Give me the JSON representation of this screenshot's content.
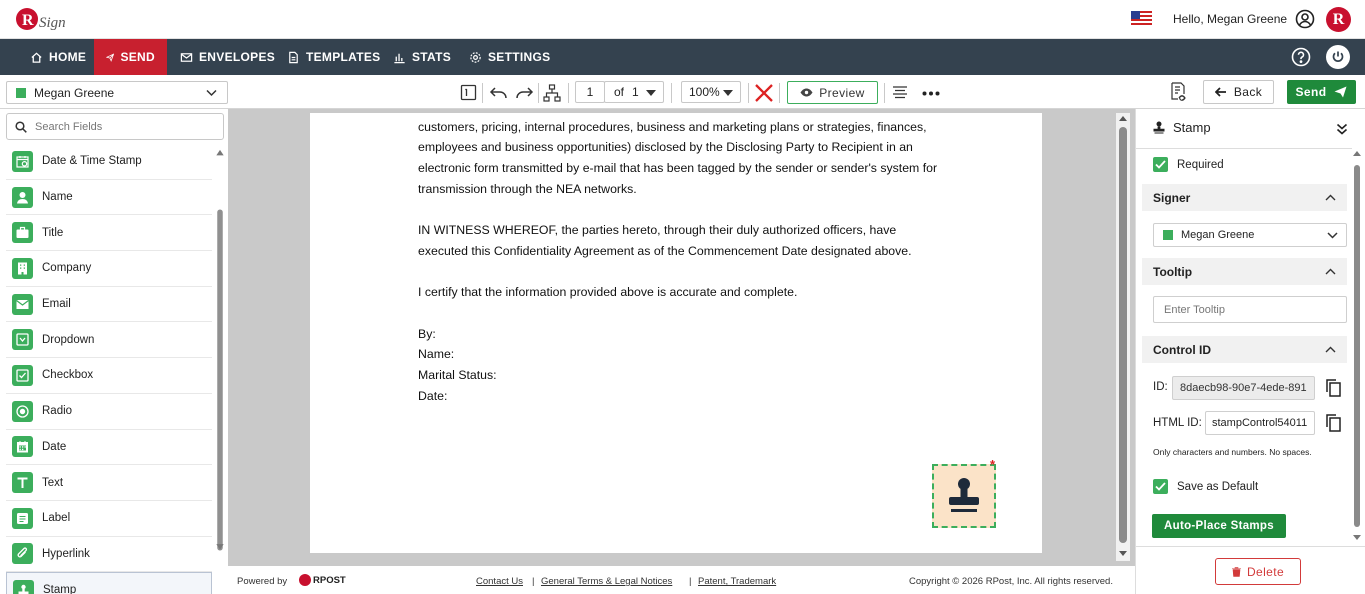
{
  "header": {
    "logo_text": "RSign",
    "greeting": "Hello, Megan Greene",
    "brand_badge": "R"
  },
  "nav": {
    "items": [
      {
        "label": "HOME",
        "icon": "home-icon"
      },
      {
        "label": "SEND",
        "icon": "paper-plane-icon",
        "active": true
      },
      {
        "label": "ENVELOPES",
        "icon": "envelope-icon"
      },
      {
        "label": "TEMPLATES",
        "icon": "document-icon"
      },
      {
        "label": "STATS",
        "icon": "bar-chart-icon"
      },
      {
        "label": "SETTINGS",
        "icon": "gear-icon"
      }
    ]
  },
  "toolbar": {
    "signer": "Megan Greene",
    "page_current": "1",
    "page_of": "of",
    "page_total": "1",
    "zoom": "100%",
    "preview_label": "Preview",
    "back_label": "Back",
    "send_label": "Send"
  },
  "left_panel": {
    "search_placeholder": "Search Fields",
    "fields": [
      {
        "label": "Date & Time Stamp",
        "icon": "calendar-clock-icon"
      },
      {
        "label": "Name",
        "icon": "person-icon"
      },
      {
        "label": "Title",
        "icon": "briefcase-icon"
      },
      {
        "label": "Company",
        "icon": "building-icon"
      },
      {
        "label": "Email",
        "icon": "envelope-icon"
      },
      {
        "label": "Dropdown",
        "icon": "dropdown-icon"
      },
      {
        "label": "Checkbox",
        "icon": "checkbox-icon"
      },
      {
        "label": "Radio",
        "icon": "radio-icon"
      },
      {
        "label": "Date",
        "icon": "calendar-icon"
      },
      {
        "label": "Text",
        "icon": "text-icon"
      },
      {
        "label": "Label",
        "icon": "label-icon"
      },
      {
        "label": "Hyperlink",
        "icon": "paperclip-icon"
      },
      {
        "label": "Stamp",
        "icon": "stamp-icon"
      }
    ]
  },
  "document": {
    "lines": [
      "customers, pricing, internal procedures, business and marketing plans or strategies, finances,",
      "employees and business opportunities) disclosed by the Disclosing Party to Recipient in an",
      "electronic form transmitted by e-mail that has been tagged by the sender or sender's system for",
      "transmission through the NEA networks.",
      "",
      "IN WITNESS WHEREOF, the parties hereto, through their duly authorized officers, have",
      "executed this Confidentiality Agreement as of the Commencement Date designated above.",
      "",
      "I certify that the information provided above is accurate and complete.",
      "",
      "By:",
      "Name:",
      "Marital Status:",
      "Date:"
    ],
    "stamp_required_marker": "*"
  },
  "footer": {
    "powered_by": "Powered by",
    "brand": "RPOST",
    "links": [
      "Contact Us",
      "General Terms & Legal Notices",
      "Patent, Trademark"
    ],
    "separator": "|",
    "copyright": "Copyright © 2026 RPost, Inc. All rights reserved."
  },
  "right_panel": {
    "title": "Stamp",
    "required_label": "Required",
    "signer_section": "Signer",
    "signer_value": "Megan Greene",
    "tooltip_section": "Tooltip",
    "tooltip_placeholder": "Enter Tooltip",
    "control_id_section": "Control ID",
    "id_label": "ID:",
    "id_value": "8daecb98-90e7-4ede-891",
    "html_id_label": "HTML ID:",
    "html_id_value": "stampControl54011",
    "html_id_hint": "Only characters and numbers. No spaces.",
    "save_default_label": "Save as Default",
    "auto_place_label": "Auto-Place Stamps",
    "delete_label": "Delete"
  },
  "colors": {
    "nav_bg": "#34424f",
    "nav_active": "#c8202f",
    "accent_green": "#3cae5c",
    "send_green": "#1f8a3b",
    "brand_red": "#c8102e",
    "stamp_bg": "#fbe3c8"
  }
}
